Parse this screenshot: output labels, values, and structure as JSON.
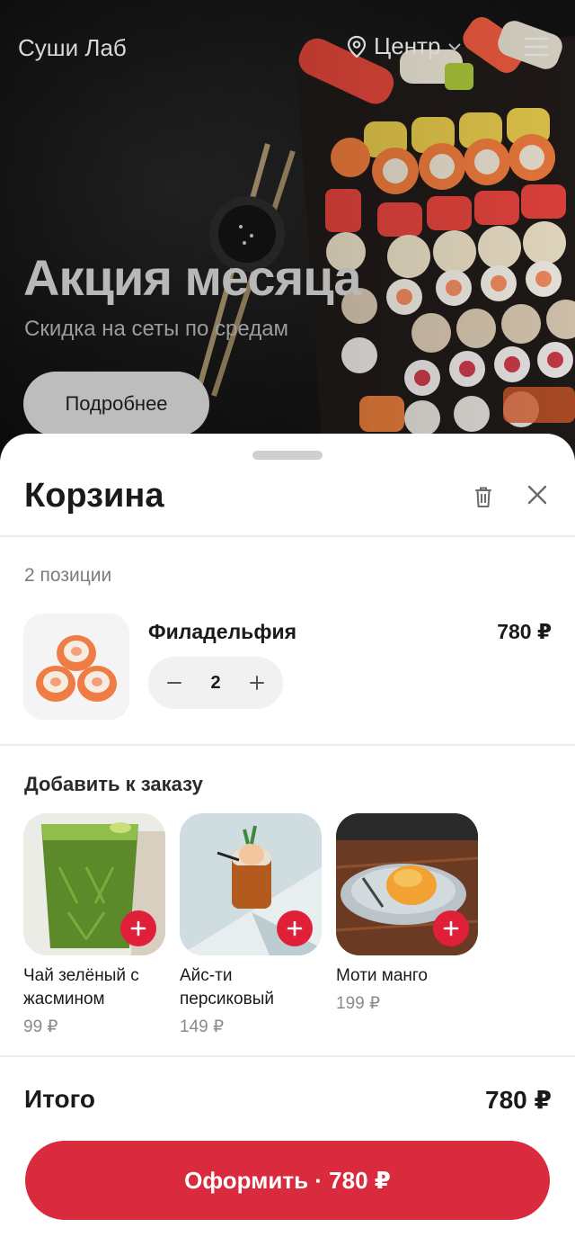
{
  "header": {
    "brand": "Суши Лаб",
    "location": "Центр",
    "location_icon": "map-pin-icon",
    "menu_icon": "hamburger-icon"
  },
  "banner": {
    "title": "Акция месяца",
    "subtitle": "Скидка на сеты по средам",
    "button_label": "Подробнее"
  },
  "cart": {
    "title": "Корзина",
    "trash_icon": "trash-icon",
    "close_icon": "close-icon",
    "count_label": "2 позиции",
    "items": [
      {
        "name": "Филадельфия",
        "price": "780 ₽",
        "quantity": "2",
        "image": "sushi-rolls-image"
      }
    ],
    "addons_title": "Добавить к заказу",
    "addons": [
      {
        "name": "Чай зелёный с жасмином",
        "price": "99 ₽",
        "image": "green-tea-image"
      },
      {
        "name": "Айс-ти персиковый",
        "price": "149 ₽",
        "image": "iced-tea-image"
      },
      {
        "name": "Моти манго",
        "price": "199 ₽",
        "image": "mochi-image"
      }
    ],
    "total_label": "Итого",
    "total_value": "780 ₽",
    "checkout_label": "Оформить · 780 ₽"
  },
  "colors": {
    "accent": "#d92a3e",
    "addon_plus": "#e02038"
  }
}
